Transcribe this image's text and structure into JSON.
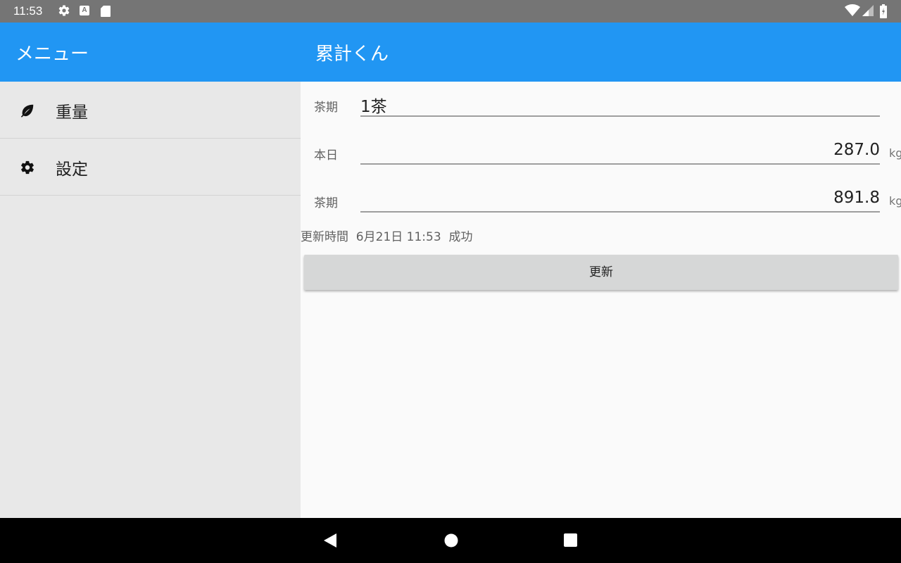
{
  "status_bar": {
    "time": "11:53",
    "icons": [
      "gear-icon",
      "a-notification-icon",
      "sd-card-icon",
      "wifi-icon",
      "signal-icon",
      "battery-icon"
    ],
    "a_badge": "A"
  },
  "app_bar": {
    "menu_title": "メニュー",
    "app_title": "累計くん",
    "color": "#2196f3"
  },
  "sidebar": {
    "items": [
      {
        "label": "重量",
        "icon": "leaf-icon"
      },
      {
        "label": "設定",
        "icon": "gear-icon"
      }
    ]
  },
  "main": {
    "rows": [
      {
        "label": "茶期",
        "value": "1茶",
        "unit": ""
      },
      {
        "label": "本日",
        "value": "287.0",
        "unit": "kg"
      },
      {
        "label": "茶期",
        "value": "891.8",
        "unit": "kg"
      }
    ],
    "status_line": "更新時間  6月21日 11:53  成功",
    "update_button": "更新"
  },
  "nav_bar": {
    "buttons": [
      "back-icon",
      "home-icon",
      "recents-icon"
    ]
  }
}
